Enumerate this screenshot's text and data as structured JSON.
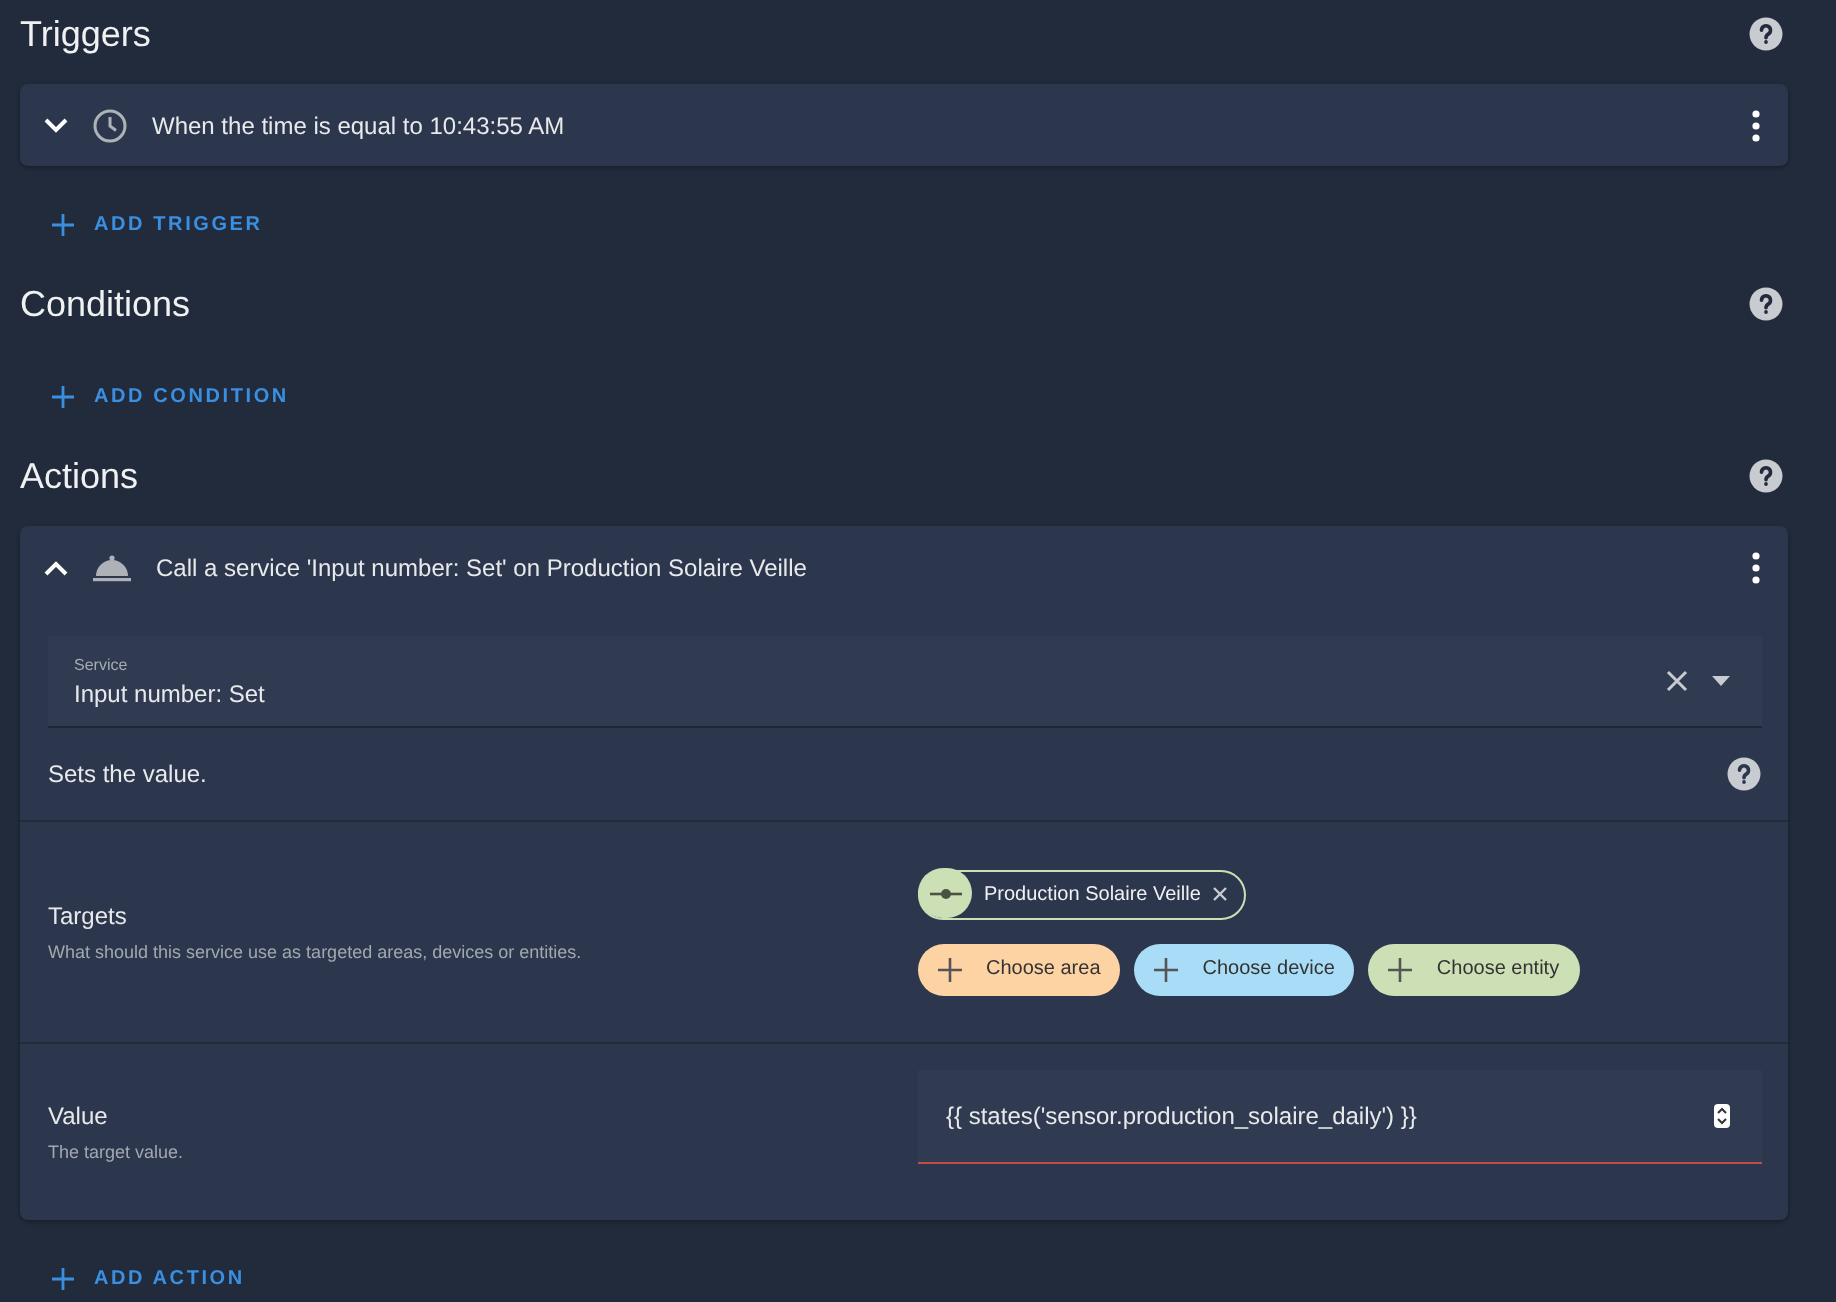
{
  "sections": [
    {
      "title": "Triggers",
      "items": [
        {
          "kind": "trigger",
          "summary": "When the time is equal to 10:43:55 AM",
          "expanded": false
        }
      ],
      "add_label": "ADD TRIGGER"
    },
    {
      "title": "Conditions",
      "add_label": "ADD CONDITION"
    },
    {
      "title": "Actions",
      "items": [
        {
          "kind": "action",
          "summary": "Call a service 'Input number: Set' on Production Solaire Veille",
          "expanded": true,
          "service": {
            "label": "Service",
            "value": "Input number: Set"
          },
          "description": "Sets the value.",
          "targets": {
            "label": "Targets",
            "hint": "What should this service use as targeted areas, devices or entities.",
            "selected": [
              {
                "label": "Production Solaire Veille",
                "color": "#cde0b5"
              }
            ],
            "choosers": [
              {
                "label": "Choose area",
                "color": "#fdd3a4"
              },
              {
                "label": "Choose device",
                "color": "#a9ddf7"
              },
              {
                "label": "Choose entity",
                "color": "#cde0b5"
              }
            ]
          },
          "value": {
            "label": "Value",
            "hint": "The target value.",
            "text": "{{ states('sensor.production_solaire_daily') }}"
          }
        }
      ],
      "add_label": "ADD ACTION"
    }
  ]
}
